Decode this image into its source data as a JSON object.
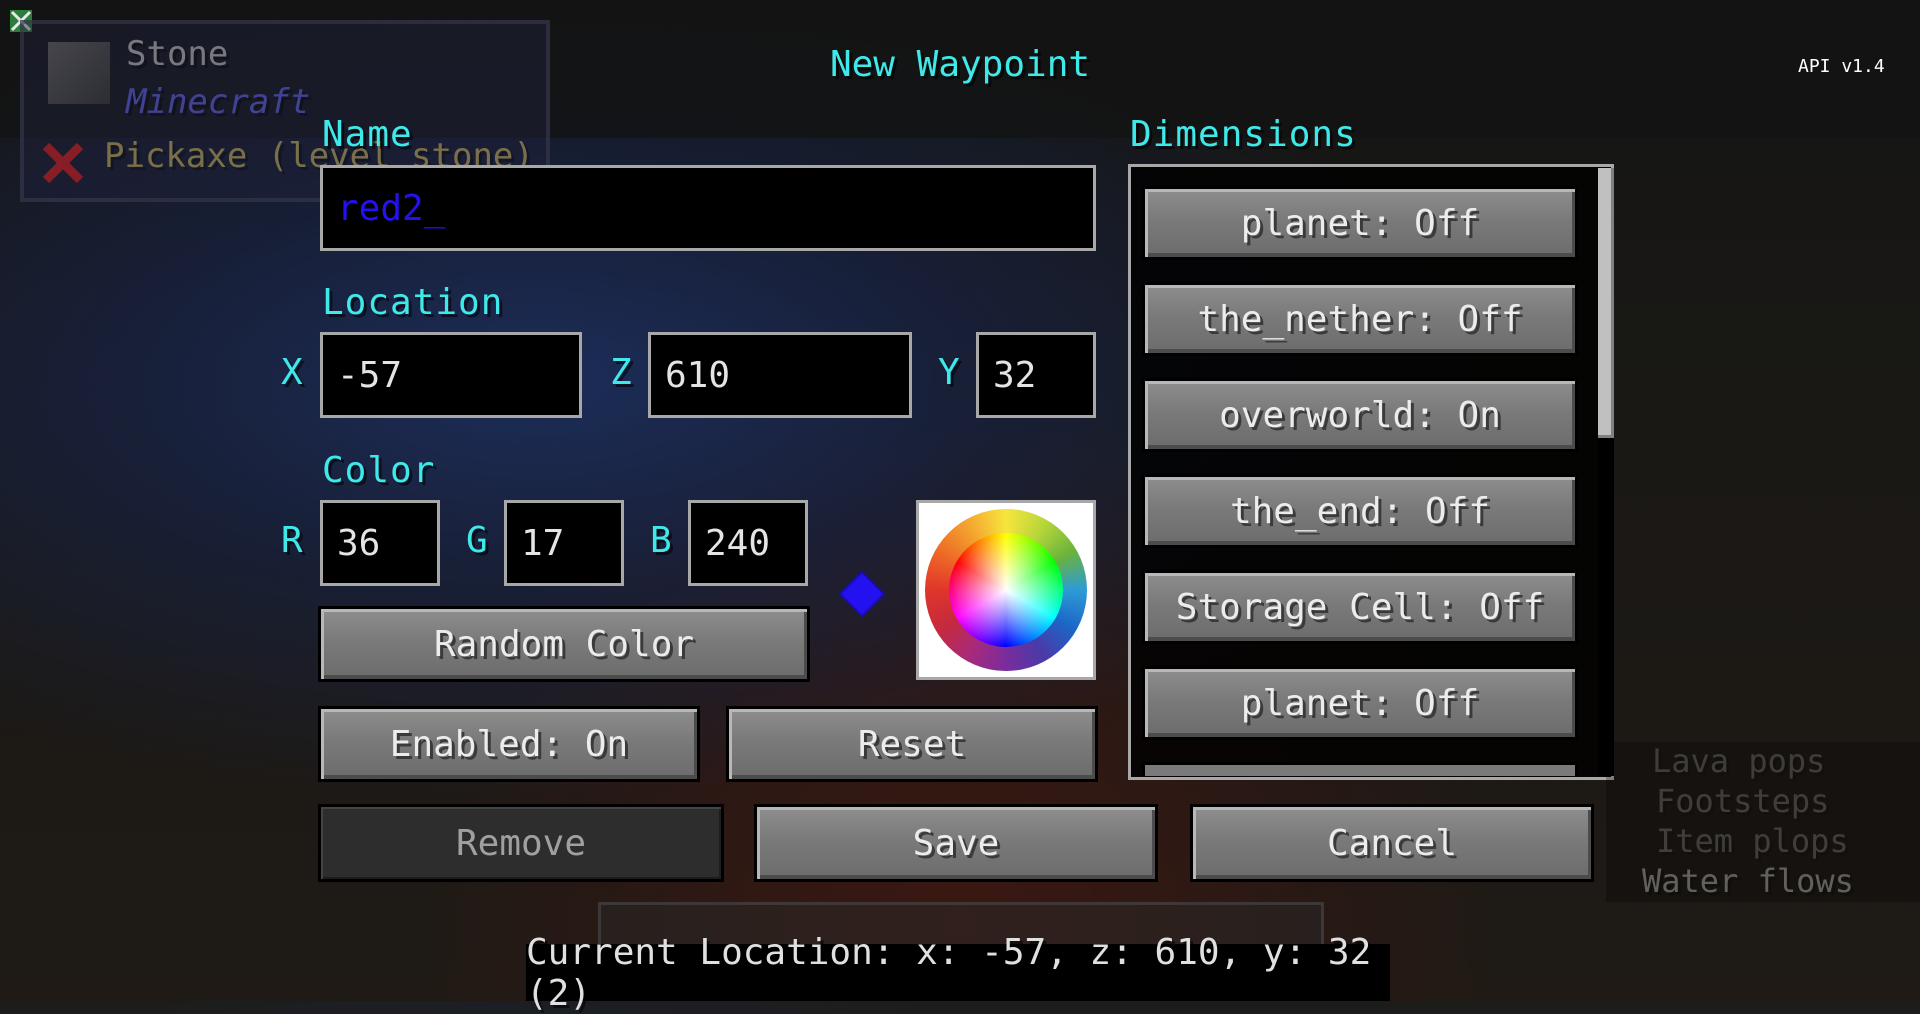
{
  "title": "New Waypoint",
  "api_version": "API v1.4",
  "hud": {
    "block_name": "Stone",
    "mod_name": "Minecraft",
    "tool_hint": "Pickaxe (level stone)"
  },
  "name": {
    "label": "Name",
    "value": "red2_"
  },
  "location": {
    "label": "Location",
    "x_label": "X",
    "x_value": "-57",
    "z_label": "Z",
    "z_value": "610",
    "y_label": "Y",
    "y_value": "32"
  },
  "color": {
    "label": "Color",
    "r_label": "R",
    "r_value": "36",
    "g_label": "G",
    "g_value": "17",
    "b_label": "B",
    "b_value": "240",
    "preview_hex": "#2411f0",
    "random_button": "Random Color"
  },
  "buttons": {
    "enabled": "Enabled: On",
    "reset": "Reset",
    "remove": "Remove",
    "save": "Save",
    "cancel": "Cancel"
  },
  "dimensions": {
    "label": "Dimensions",
    "items": [
      {
        "label": "planet: Off"
      },
      {
        "label": "the_nether: Off"
      },
      {
        "label": "overworld: On"
      },
      {
        "label": "the_end: Off"
      },
      {
        "label": "Storage Cell: Off"
      },
      {
        "label": "planet: Off"
      }
    ]
  },
  "sound_subtitles": [
    "Lava pops",
    "Footsteps",
    "Item plops",
    "Water flows"
  ],
  "current_location": "Current Location:  x: -57, z: 610, y: 32 (2)",
  "colors": {
    "accent_cyan": "#3fe9ea",
    "name_text_blue": "#2411f0"
  }
}
